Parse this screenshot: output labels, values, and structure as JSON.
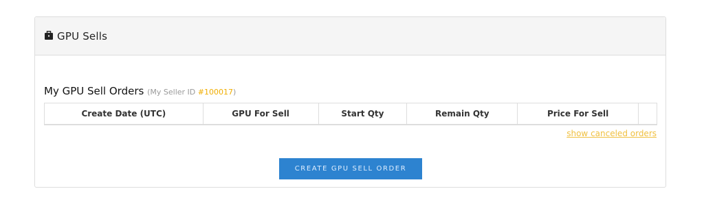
{
  "panel": {
    "title": "GPU Sells",
    "icon": "briefcase-icon"
  },
  "orders": {
    "title": "My GPU Sell Orders",
    "seller_prefix": "(My Seller ID ",
    "seller_id": "#100017",
    "seller_suffix": ")",
    "columns": [
      "Create Date (UTC)",
      "GPU For Sell",
      "Start Qty",
      "Remain Qty",
      "Price For Sell",
      ""
    ],
    "rows": [],
    "show_canceled_label": "show canceled orders"
  },
  "actions": {
    "create_label": "CREATE GPU SELL ORDER",
    "accent_color": "#2d83d0",
    "link_color": "#f0c040"
  }
}
